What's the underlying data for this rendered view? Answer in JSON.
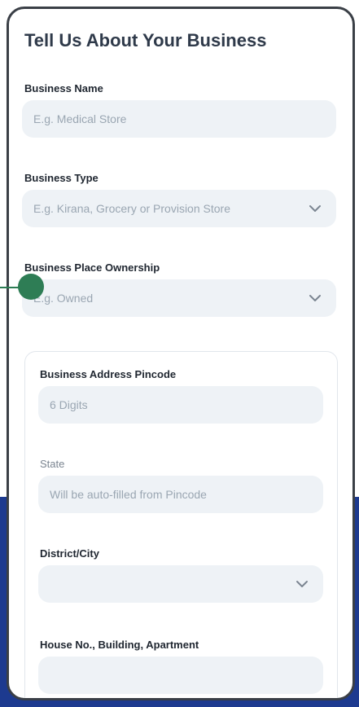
{
  "form": {
    "title": "Tell Us About Your Business",
    "business_name": {
      "label": "Business Name",
      "placeholder": "E.g. Medical Store"
    },
    "business_type": {
      "label": "Business Type",
      "placeholder": "E.g. Kirana, Grocery or Provision Store"
    },
    "ownership": {
      "label": "Business Place Ownership",
      "placeholder": "E.g. Owned"
    },
    "address": {
      "pincode": {
        "label": "Business Address Pincode",
        "placeholder": "6 Digits"
      },
      "state": {
        "label": "State",
        "placeholder": "Will be auto-filled from Pincode"
      },
      "district": {
        "label": "District/City",
        "placeholder": ""
      },
      "house": {
        "label": "House No., Building, Apartment",
        "placeholder": ""
      }
    }
  },
  "colors": {
    "accent_green": "#2e7d55",
    "background_blue": "#1d3a8f",
    "field_bg": "#eef2f6"
  }
}
